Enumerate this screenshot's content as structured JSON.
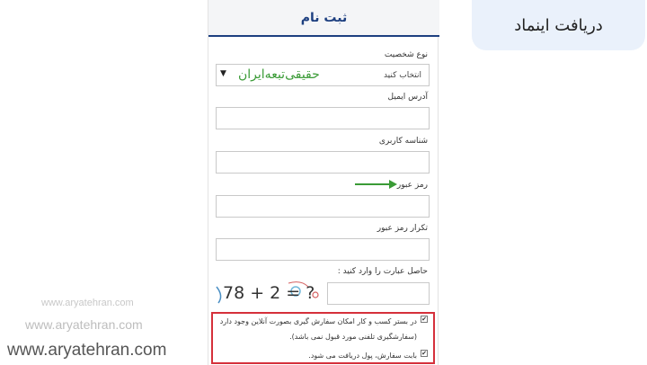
{
  "tag": {
    "label": "دریافت اینماد"
  },
  "watermarks": {
    "small": "www.aryatehran.com",
    "medium": "www.aryatehran.com",
    "large": "www.aryatehran.com"
  },
  "header": {
    "title": "ثبت نام"
  },
  "form": {
    "entity_type": {
      "label": "نوع شخصیت",
      "prompt": "انتخاب کنید",
      "selected": "حقیقی‌تبعه‌ایران"
    },
    "email": {
      "label": "آدرس ایمیل",
      "value": ""
    },
    "username": {
      "label": "شناسه کاربری",
      "value": ""
    },
    "password": {
      "label": "رمز عبور",
      "value": ""
    },
    "password_repeat": {
      "label": "تکرار رمز عبور",
      "value": ""
    },
    "captcha": {
      "label": "حاصل عبارت را وارد کنید :",
      "image_text": "78 + 2 = ?",
      "value": ""
    }
  },
  "notice": {
    "item1_line1": "در بستر کسب و کار امکان سفارش گیری بصورت آنلاین وجود دارد",
    "item1_line2": "(سفارشگیری تلفنی مورد قبول نمی باشد).",
    "item2": "بابت سفارش، پول دریافت می شود."
  },
  "colors": {
    "header_accent": "#1d3f80",
    "selected_text": "#3a9b36",
    "arrow": "#3a9b36",
    "notice_border": "#d5303b",
    "tag_background": "#eaf1fb"
  },
  "icons": {
    "dropdown": "triangle-down",
    "arrow": "arrow-right",
    "checkbox": "checked-box"
  }
}
